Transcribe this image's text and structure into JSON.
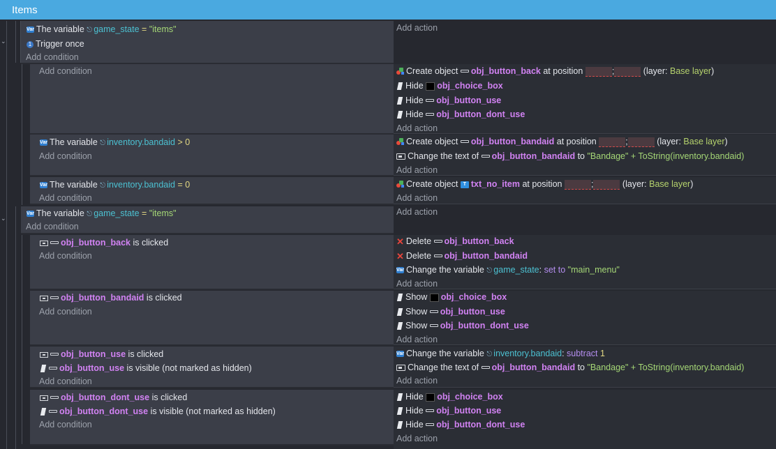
{
  "header": {
    "title": "Items"
  },
  "labels": {
    "add_condition": "Add condition",
    "add_action": "Add action",
    "the_variable": "The variable",
    "trigger_once": "Trigger once",
    "create_object": "Create object",
    "at_position": "at position",
    "layer_open": "(layer:",
    "layer_close": ")",
    "base_layer": "Base layer",
    "hide": "Hide",
    "show": "Show",
    "change_text_of": "Change the text of",
    "to": "to",
    "is_clicked": "is clicked",
    "is_visible": "is visible (not marked as hidden)",
    "delete": "Delete",
    "change_variable": "Change the variable",
    "colon": ":",
    "set_to": "set to",
    "subtract": "subtract",
    "semicolon": ";"
  },
  "vars": {
    "game_state": "game_state",
    "inventory_bandaid": "inventory.bandaid"
  },
  "ops": {
    "eq": "=",
    "gt": ">"
  },
  "values": {
    "items": "\"items\"",
    "zero": "0",
    "one": "1",
    "main_menu": "\"main_menu\"",
    "bandage_expr_str": "\"Bandage\"",
    "plus": "+",
    "tostring_expr": "ToString(inventory.bandaid)"
  },
  "objects": {
    "obj_button_back": "obj_button_back",
    "obj_choice_box": "obj_choice_box",
    "obj_button_use": "obj_button_use",
    "obj_button_dont_use": "obj_button_dont_use",
    "obj_button_bandaid": "obj_button_bandaid",
    "txt_no_item": "txt_no_item"
  },
  "colors": {
    "header": "#4aa9e0",
    "object_name": "#d182f2",
    "variable": "#4cc1d2",
    "string": "#a5d776"
  },
  "icons": [
    "variable-icon",
    "trigger-once-icon",
    "create-object-icon",
    "hide-icon",
    "show-icon",
    "sprite-icon",
    "text-icon",
    "click-icon",
    "delete-icon",
    "text-object-icon",
    "reference-icon"
  ]
}
